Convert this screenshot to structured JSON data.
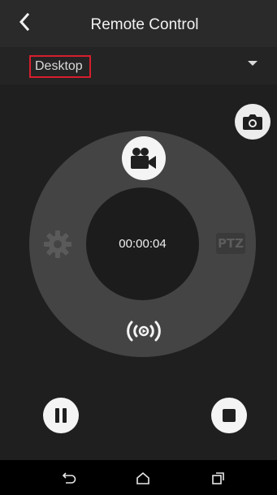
{
  "header": {
    "title": "Remote Control",
    "back_icon": "back-arrow-icon"
  },
  "device_selector": {
    "selected": "Desktop",
    "icon": "dropdown-arrow-icon"
  },
  "controls": {
    "timer": "00:00:04",
    "ptz_label": "PTZ",
    "snapshot_icon": "camera-icon",
    "record_icon": "video-camera-icon",
    "settings_icon": "gear-icon",
    "live_icon": "broadcast-icon",
    "pause_icon": "pause-icon",
    "stop_icon": "stop-icon"
  },
  "navigation": {
    "back_icon": "nav-back-icon",
    "home_icon": "nav-home-icon",
    "recents_icon": "nav-recents-icon"
  },
  "colors": {
    "highlight_border": "#d61e2c",
    "ring": "#444444",
    "button": "#f4f4f4"
  }
}
